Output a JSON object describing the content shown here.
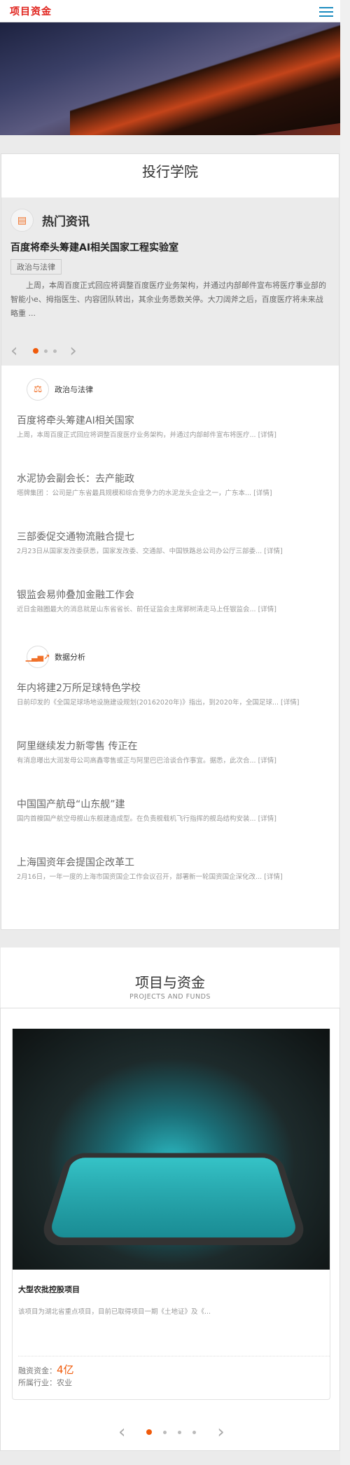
{
  "header": {
    "logo": "项目资金",
    "menu_icon": "hamburger-icon"
  },
  "banner": {
    "slides": 3,
    "active": 3,
    "accent": "#f05a0a"
  },
  "academy": {
    "title": "投行学院",
    "hot": {
      "icon": "document-icon",
      "title": "热门资讯",
      "news_title": "百度将牵头筹建AI相关国家工程实验室",
      "tag": "政治与法律",
      "desc": "上周，本周百度正式回应将调整百度医疗业务架构，并通过内部邮件宣布将医疗事业部的智能小e、拇指医生、内容团队转出，其余业务悉数关停。大刀阔斧之后，百度医疗将未来战略重 ...",
      "prev": "‹",
      "next": "›",
      "active_dot": 1
    },
    "categories": [
      {
        "icon": "scales-icon",
        "name": "政治与法律",
        "items": [
          {
            "title": "百度将牵头筹建AI相关国家",
            "summary": "上周，本周百度正式回应将调整百度医疗业务架构，并通过内部邮件宣布将医疗...",
            "more": "[详情]"
          },
          {
            "title": "水泥协会副会长：去产能政",
            "summary": "塔牌集团 ：公司是广东省最具规模和综合竞争力的水泥龙头企业之一，广东本...",
            "more": "[详情]"
          },
          {
            "title": "三部委促交通物流融合提七",
            "summary": "2月23日从国家发改委获悉，国家发改委、交通部、中国铁路总公司办公厅三部委...",
            "more": "[详情]"
          },
          {
            "title": "银监会易帅叠加金融工作会",
            "summary": "近日金融圈最大的消息就是山东省省长、前任证监会主席郭树清走马上任银监会...",
            "more": "[详情]"
          }
        ]
      },
      {
        "icon": "bar-chart-icon",
        "name": "数据分析",
        "items": [
          {
            "title": "年内将建2万所足球特色学校",
            "summary": "日前印发的《全国足球场地设施建设规划(20162020年)》指出，到2020年，全国足球...",
            "more": "[详情]"
          },
          {
            "title": "阿里继续发力新零售 传正在",
            "summary": "有消息曝出大润发母公司高鑫零售或正与阿里巴巴洽谈合作事宜。据悉，此次合...",
            "more": "[详情]"
          },
          {
            "title": "中国国产航母“山东舰”建",
            "summary": "国内首艘国产航空母舰山东舰建造成型。在负责舰载机飞行指挥的舰岛结构安装...",
            "more": "[详情]"
          },
          {
            "title": "上海国资年会提国企改革工",
            "summary": "2月16日，一年一度的上海市国资国企工作会议召开，部署新一轮国资国企深化改...",
            "more": "[详情]"
          }
        ]
      }
    ]
  },
  "projects": {
    "title": "项目与资金",
    "subtitle": "PROJECTS AND FUNDS",
    "item": {
      "name": "大型农批控股项目",
      "desc": "该项目为湖北省重点项目，目前已取得项目一期《土地证》及《...",
      "fund_label": "融资资金：",
      "fund_value": "4亿",
      "industry_label": "所属行业：",
      "industry_value": "农业"
    },
    "prev": "‹",
    "next": "›",
    "dots": 4,
    "active_dot": 1
  }
}
